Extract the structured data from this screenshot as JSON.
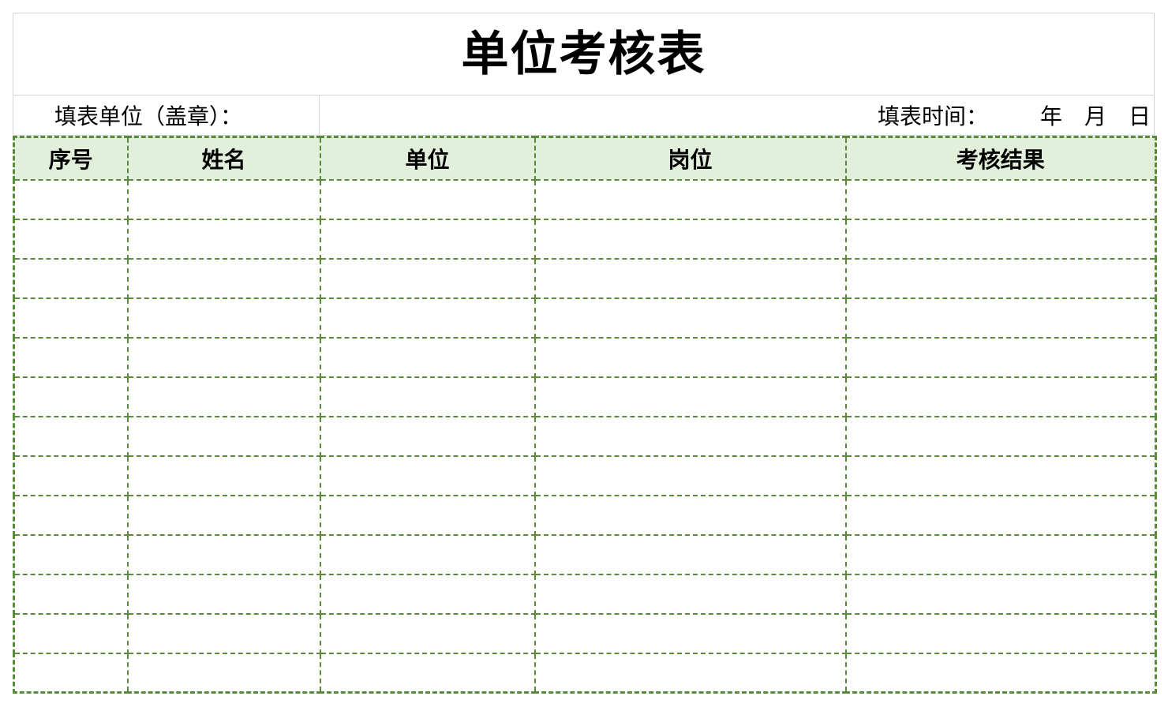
{
  "title": "单位考核表",
  "info": {
    "unit_label": "填表单位（盖章）：",
    "time_label": "填表时间：",
    "year": "年",
    "month": "月",
    "day": "日"
  },
  "table": {
    "headers": [
      "序号",
      "姓名",
      "单位",
      "岗位",
      "考核结果"
    ],
    "row_count": 13
  },
  "colors": {
    "header_fill": "#e2efda",
    "border_green": "#5a8a3c",
    "frame_gray": "#d4d4d4"
  }
}
